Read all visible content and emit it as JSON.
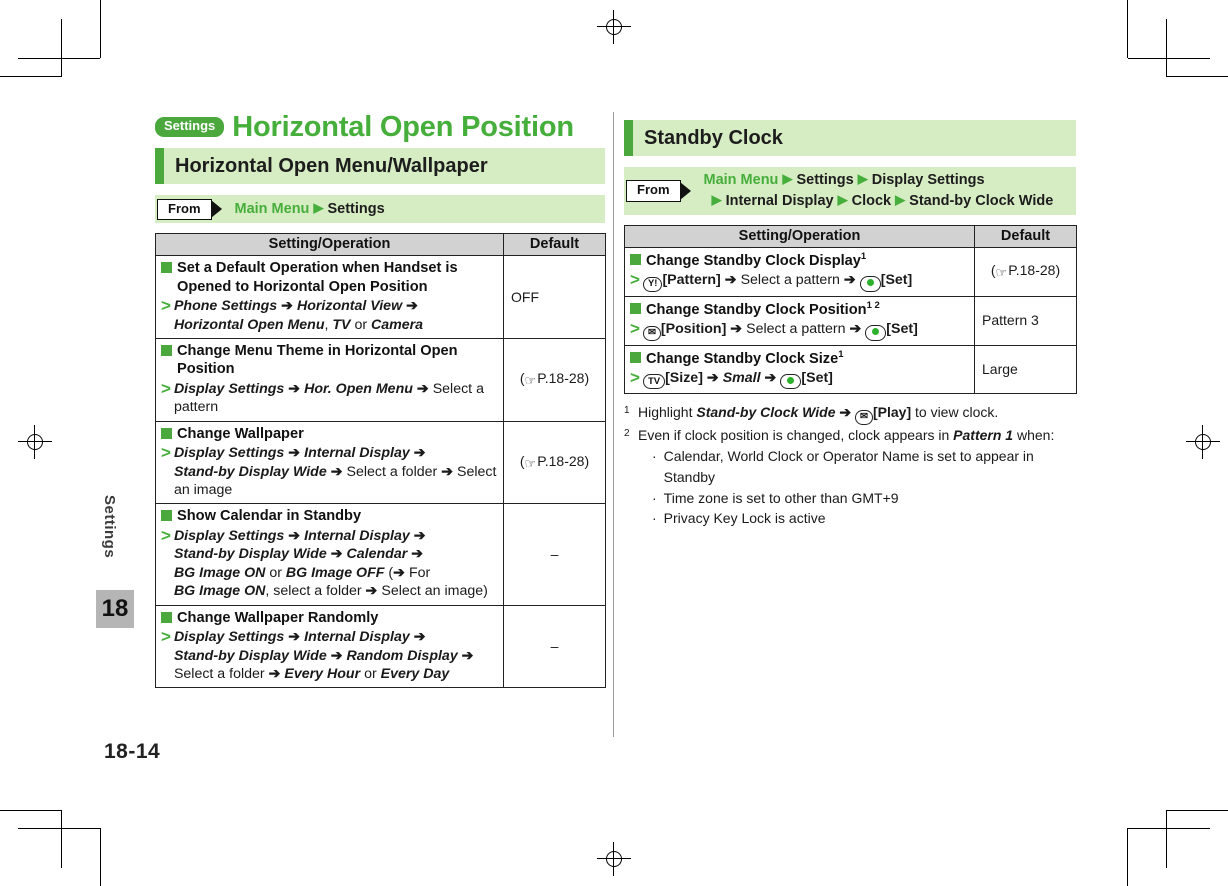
{
  "page": {
    "number": "18-14",
    "chapter_tab": "18",
    "chapter_side_label": "Settings"
  },
  "left": {
    "badge": "Settings",
    "title": "Horizontal Open Position",
    "section": "Horizontal Open Menu/Wallpaper",
    "from": {
      "label": "From",
      "path_main": "Main Menu",
      "path_rest": "Settings"
    },
    "table": {
      "headers": [
        "Setting/Operation",
        "Default"
      ],
      "rows": [
        {
          "heading": "Set a Default Operation when Handset is Opened to Horizontal Open Position",
          "operation": "Phone Settings → Horizontal View → Horizontal Open Menu, TV or Camera",
          "default": "OFF",
          "default_ref": ""
        },
        {
          "heading": "Change Menu Theme in Horizontal Open Position",
          "operation": "Display Settings → Hor. Open Menu → Select a pattern",
          "default": "",
          "default_ref": "(☞P_REF P.18-28)"
        },
        {
          "heading": "Change Wallpaper",
          "operation": "Display Settings → Internal Display → Stand-by Display Wide → Select a folder → Select an image",
          "default": "",
          "default_ref": "(☞P_REF P.18-28)"
        },
        {
          "heading": "Show Calendar in Standby",
          "operation": "Display Settings → Internal Display → Stand-by Display Wide → Calendar → BG Image ON or BG Image OFF (→ For BG Image ON, select a folder → Select an image)",
          "default": "–",
          "default_ref": ""
        },
        {
          "heading": "Change Wallpaper Randomly",
          "operation": "Display Settings → Internal Display → Stand-by Display Wide → Random Display → Select a folder → Every Hour or Every Day",
          "default": "–",
          "default_ref": ""
        }
      ]
    }
  },
  "right": {
    "section": "Standby Clock",
    "from": {
      "label": "From",
      "path_main": "Main Menu",
      "path_line1_rest": "Settings  Display Settings",
      "path_line2": "Internal Display  Clock  Stand-by Clock Wide"
    },
    "table": {
      "headers": [
        "Setting/Operation",
        "Default"
      ],
      "rows": [
        {
          "heading": "Change Standby Clock Display",
          "heading_sup": "1",
          "operation": "[Pattern] → Select a pattern → [Set]",
          "key_icon": "yahoo-key-icon",
          "key_icon_label": "Y!",
          "default": "",
          "default_ref": "(☞P_REF P.18-28)"
        },
        {
          "heading": "Change Standby Clock Position",
          "heading_sup": "1 2",
          "operation": "[Position] → Select a pattern → [Set]",
          "key_icon": "mail-key-icon",
          "key_icon_label": "✉",
          "default": "Pattern 3",
          "default_ref": ""
        },
        {
          "heading": "Change Standby Clock Size",
          "heading_sup": "1",
          "operation": "[Size] → Small → [Set]",
          "key_icon": "tv-key-icon",
          "key_icon_label": "TV",
          "default": "Large",
          "default_ref": ""
        }
      ]
    },
    "footnotes": [
      {
        "num": "1",
        "text": "Highlight Stand-by Clock Wide → [Play] to view clock."
      },
      {
        "num": "2",
        "text": "Even if clock position is changed, clock appears in Pattern 1 when:",
        "bullets": [
          "Calendar, World Clock or Operator Name is set to appear in Standby",
          "Time zone is set to other than GMT+9",
          "Privacy Key Lock is active"
        ]
      }
    ]
  },
  "colors": {
    "brand_green": "#46ae3b",
    "band_green": "#d6ecc2",
    "accent_bar": "#4aa83d",
    "table_header_gray": "#d2d2d2",
    "tab_gray": "#b5b5b5"
  },
  "labels": {
    "ref_page": "P.18-28",
    "dash": "–"
  }
}
